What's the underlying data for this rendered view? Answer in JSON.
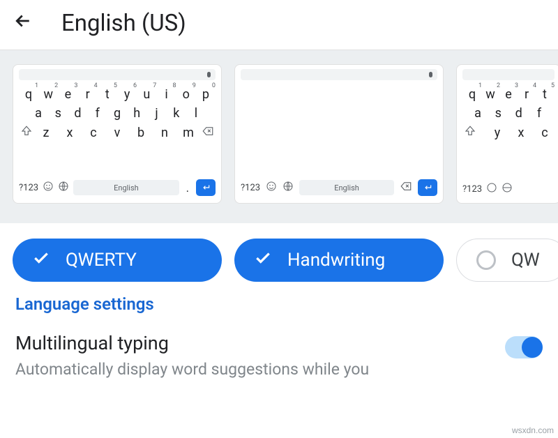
{
  "header": {
    "title": "English (US)"
  },
  "carousel": {
    "qwerty": {
      "row1": [
        {
          "k": "q",
          "s": "1"
        },
        {
          "k": "w",
          "s": "2"
        },
        {
          "k": "e",
          "s": "3"
        },
        {
          "k": "r",
          "s": "4"
        },
        {
          "k": "t",
          "s": "5"
        },
        {
          "k": "y",
          "s": "6"
        },
        {
          "k": "u",
          "s": "7"
        },
        {
          "k": "i",
          "s": "8"
        },
        {
          "k": "o",
          "s": "9"
        },
        {
          "k": "p",
          "s": "0"
        }
      ],
      "row2": [
        "a",
        "s",
        "d",
        "f",
        "g",
        "h",
        "j",
        "k",
        "l"
      ],
      "row3": [
        "z",
        "x",
        "c",
        "v",
        "b",
        "n",
        "m"
      ],
      "sym": "?123",
      "space": "English",
      "dot": "."
    },
    "handwriting": {
      "sym": "?123",
      "space": "English"
    },
    "third": {
      "row1": [
        {
          "k": "q",
          "s": "1"
        },
        {
          "k": "w",
          "s": "2"
        },
        {
          "k": "e",
          "s": "3"
        },
        {
          "k": "r",
          "s": "4"
        },
        {
          "k": "t",
          "s": "5"
        }
      ],
      "row2": [
        "a",
        "s",
        "d",
        "f"
      ],
      "row3": [
        "y",
        "x",
        "c"
      ],
      "sym": "?123"
    }
  },
  "chips": {
    "qwerty": "QWERTY",
    "handwriting": "Handwriting",
    "third": "QW"
  },
  "section": {
    "title": "Language settings",
    "multilingual": {
      "label": "Multilingual typing",
      "desc": "Automatically display word suggestions while you"
    }
  },
  "watermark": "wsxdn.com"
}
